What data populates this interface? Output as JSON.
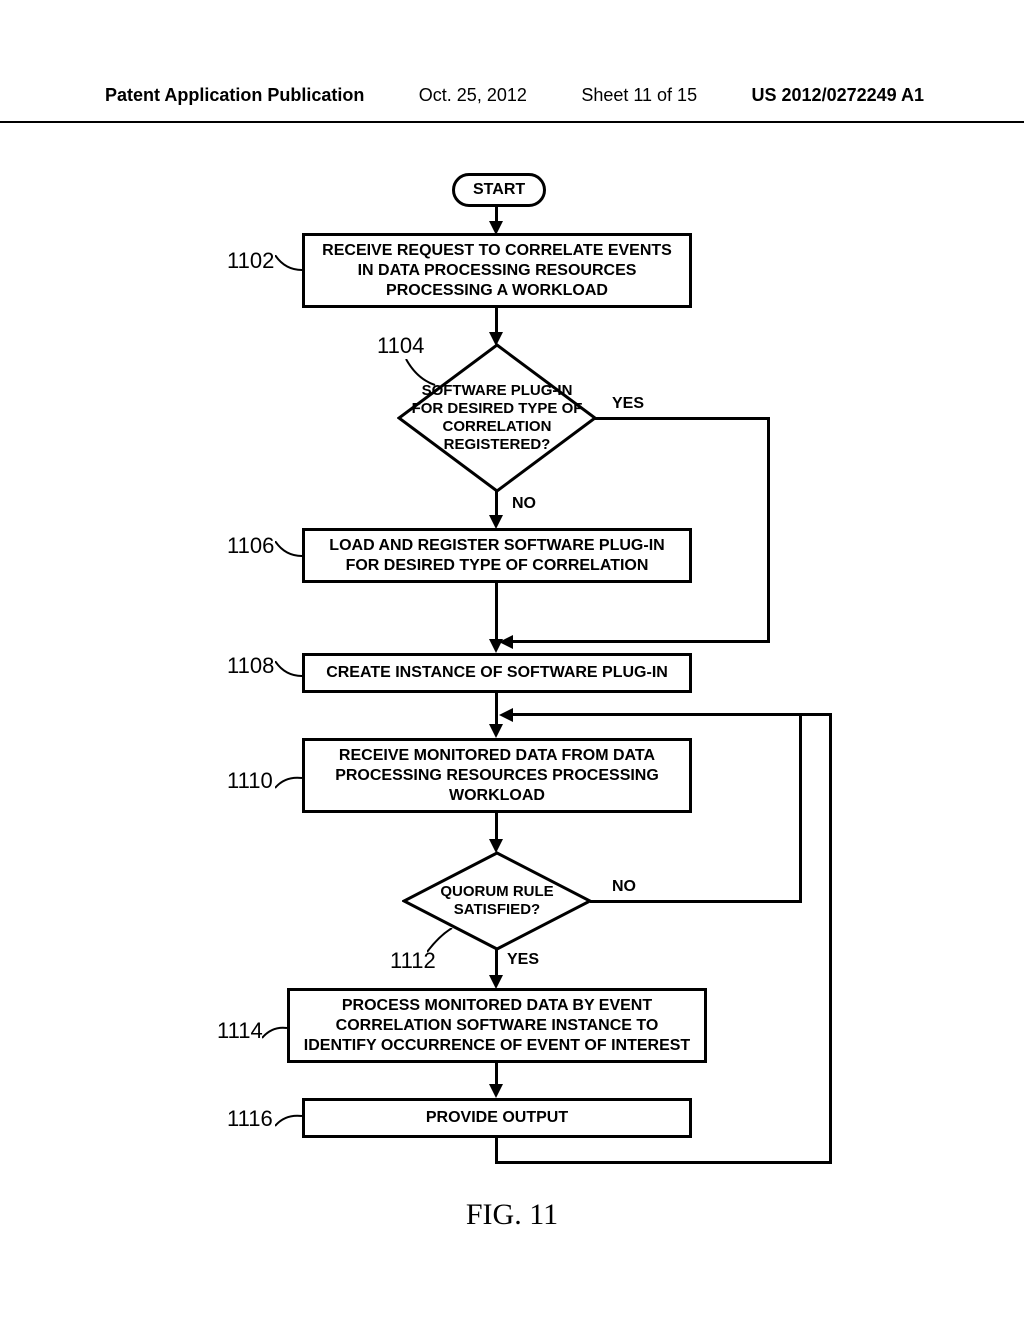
{
  "header": {
    "pub": "Patent Application Publication",
    "date": "Oct. 25, 2012",
    "sheet": "Sheet 11 of 15",
    "docnum": "US 2012/0272249 A1"
  },
  "refs": {
    "r1102": "1102",
    "r1104": "1104",
    "r1106": "1106",
    "r1108": "1108",
    "r1110": "1110",
    "r1112": "1112",
    "r1114": "1114",
    "r1116": "1116"
  },
  "nodes": {
    "start": "START",
    "n1102": "RECEIVE REQUEST TO CORRELATE EVENTS IN DATA PROCESSING RESOURCES PROCESSING A WORKLOAD",
    "n1104": "SOFTWARE PLUG-IN FOR DESIRED TYPE OF CORRELATION REGISTERED?",
    "n1106": "LOAD AND REGISTER SOFTWARE PLUG-IN FOR DESIRED TYPE OF CORRELATION",
    "n1108": "CREATE INSTANCE OF SOFTWARE PLUG-IN",
    "n1110": "RECEIVE MONITORED DATA FROM DATA PROCESSING RESOURCES PROCESSING WORKLOAD",
    "n1112": "QUORUM RULE SATISFIED?",
    "n1114": "PROCESS MONITORED DATA BY EVENT CORRELATION SOFTWARE INSTANCE TO IDENTIFY OCCURRENCE OF EVENT OF INTEREST",
    "n1116": "PROVIDE OUTPUT"
  },
  "edges": {
    "yes": "YES",
    "no": "NO"
  },
  "figure": "FIG. 11"
}
